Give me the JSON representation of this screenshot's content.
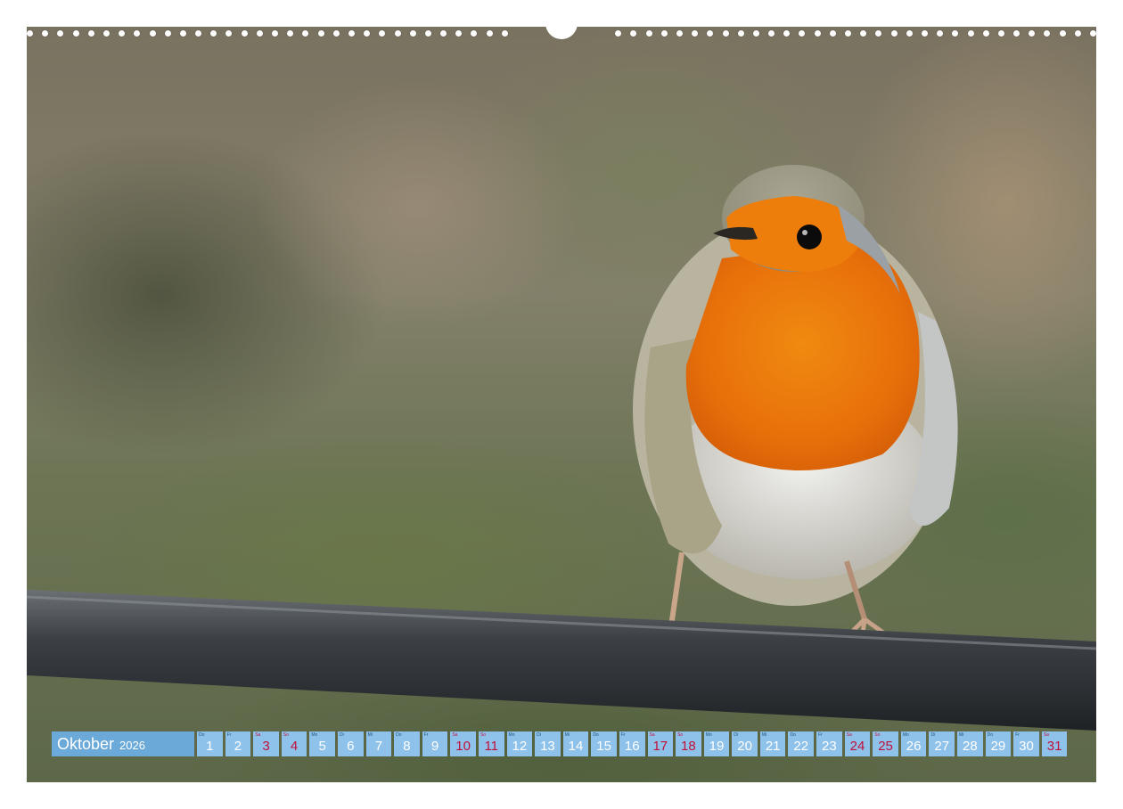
{
  "calendar": {
    "month": "Oktober",
    "year": "2026",
    "days": [
      {
        "wd": "Do",
        "n": "1",
        "we": false
      },
      {
        "wd": "Fr",
        "n": "2",
        "we": false
      },
      {
        "wd": "Sa",
        "n": "3",
        "we": true
      },
      {
        "wd": "So",
        "n": "4",
        "we": true
      },
      {
        "wd": "Mo",
        "n": "5",
        "we": false
      },
      {
        "wd": "Di",
        "n": "6",
        "we": false
      },
      {
        "wd": "Mi",
        "n": "7",
        "we": false
      },
      {
        "wd": "Do",
        "n": "8",
        "we": false
      },
      {
        "wd": "Fr",
        "n": "9",
        "we": false
      },
      {
        "wd": "Sa",
        "n": "10",
        "we": true
      },
      {
        "wd": "So",
        "n": "11",
        "we": true
      },
      {
        "wd": "Mo",
        "n": "12",
        "we": false
      },
      {
        "wd": "Di",
        "n": "13",
        "we": false
      },
      {
        "wd": "Mi",
        "n": "14",
        "we": false
      },
      {
        "wd": "Do",
        "n": "15",
        "we": false
      },
      {
        "wd": "Fr",
        "n": "16",
        "we": false
      },
      {
        "wd": "Sa",
        "n": "17",
        "we": true
      },
      {
        "wd": "So",
        "n": "18",
        "we": true
      },
      {
        "wd": "Mo",
        "n": "19",
        "we": false
      },
      {
        "wd": "Di",
        "n": "20",
        "we": false
      },
      {
        "wd": "Mi",
        "n": "21",
        "we": false
      },
      {
        "wd": "Do",
        "n": "22",
        "we": false
      },
      {
        "wd": "Fr",
        "n": "23",
        "we": false
      },
      {
        "wd": "Sa",
        "n": "24",
        "we": true
      },
      {
        "wd": "So",
        "n": "25",
        "we": true
      },
      {
        "wd": "Mo",
        "n": "26",
        "we": false
      },
      {
        "wd": "Di",
        "n": "27",
        "we": false
      },
      {
        "wd": "Mi",
        "n": "28",
        "we": false
      },
      {
        "wd": "Do",
        "n": "29",
        "we": false
      },
      {
        "wd": "Fr",
        "n": "30",
        "we": false
      },
      {
        "wd": "Sa",
        "n": "31",
        "we": true
      }
    ]
  },
  "colors": {
    "month_bg": "#6aa9d8",
    "day_bg": "#8fc2ea",
    "weekend_text": "#c0103a"
  }
}
